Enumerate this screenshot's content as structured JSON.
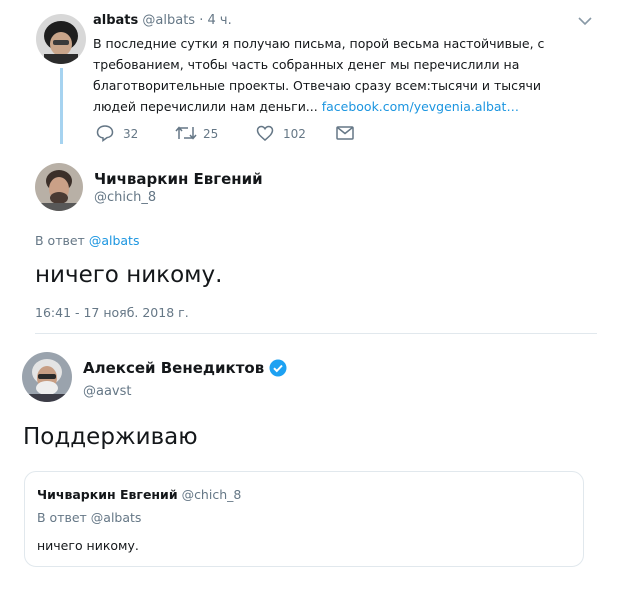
{
  "tweet1": {
    "name": "albats",
    "handle": "@albats",
    "time": "· 4 ч.",
    "text": "В последние сутки я получаю письма, порой весьма настойчивые, с требованием, чтобы часть собранных денег мы перечислили на благотворительные проекты. Отвечаю сразу всем:тысячи и тысячи людей перечислили нам деньги...",
    "link": "facebook.com/yevgenia.albat…",
    "replies": "32",
    "retweets": "25",
    "likes": "102"
  },
  "tweet2": {
    "name": "Чичваркин Евгений",
    "handle": "@chich_8",
    "reply_prefix": "В ответ",
    "reply_to": "@albats",
    "text": "ничего никому.",
    "timestamp": "16:41 - 17 нояб. 2018 г."
  },
  "tweet3": {
    "name": "Алексей Венедиктов",
    "handle": "@aavst",
    "text": "Поддерживаю"
  },
  "quote": {
    "name": "Чичваркин Евгений",
    "handle": "@chich_8",
    "reply_line": "В ответ @albats",
    "text": "ничего никому."
  },
  "colors": {
    "accent": "#1b95e0",
    "muted": "#657786",
    "thread_line": "#a6d3f0",
    "verified": "#1da1f2"
  },
  "icons": [
    "chevron-down-icon",
    "reply-icon",
    "retweet-icon",
    "like-icon",
    "message-icon",
    "verified-icon"
  ]
}
